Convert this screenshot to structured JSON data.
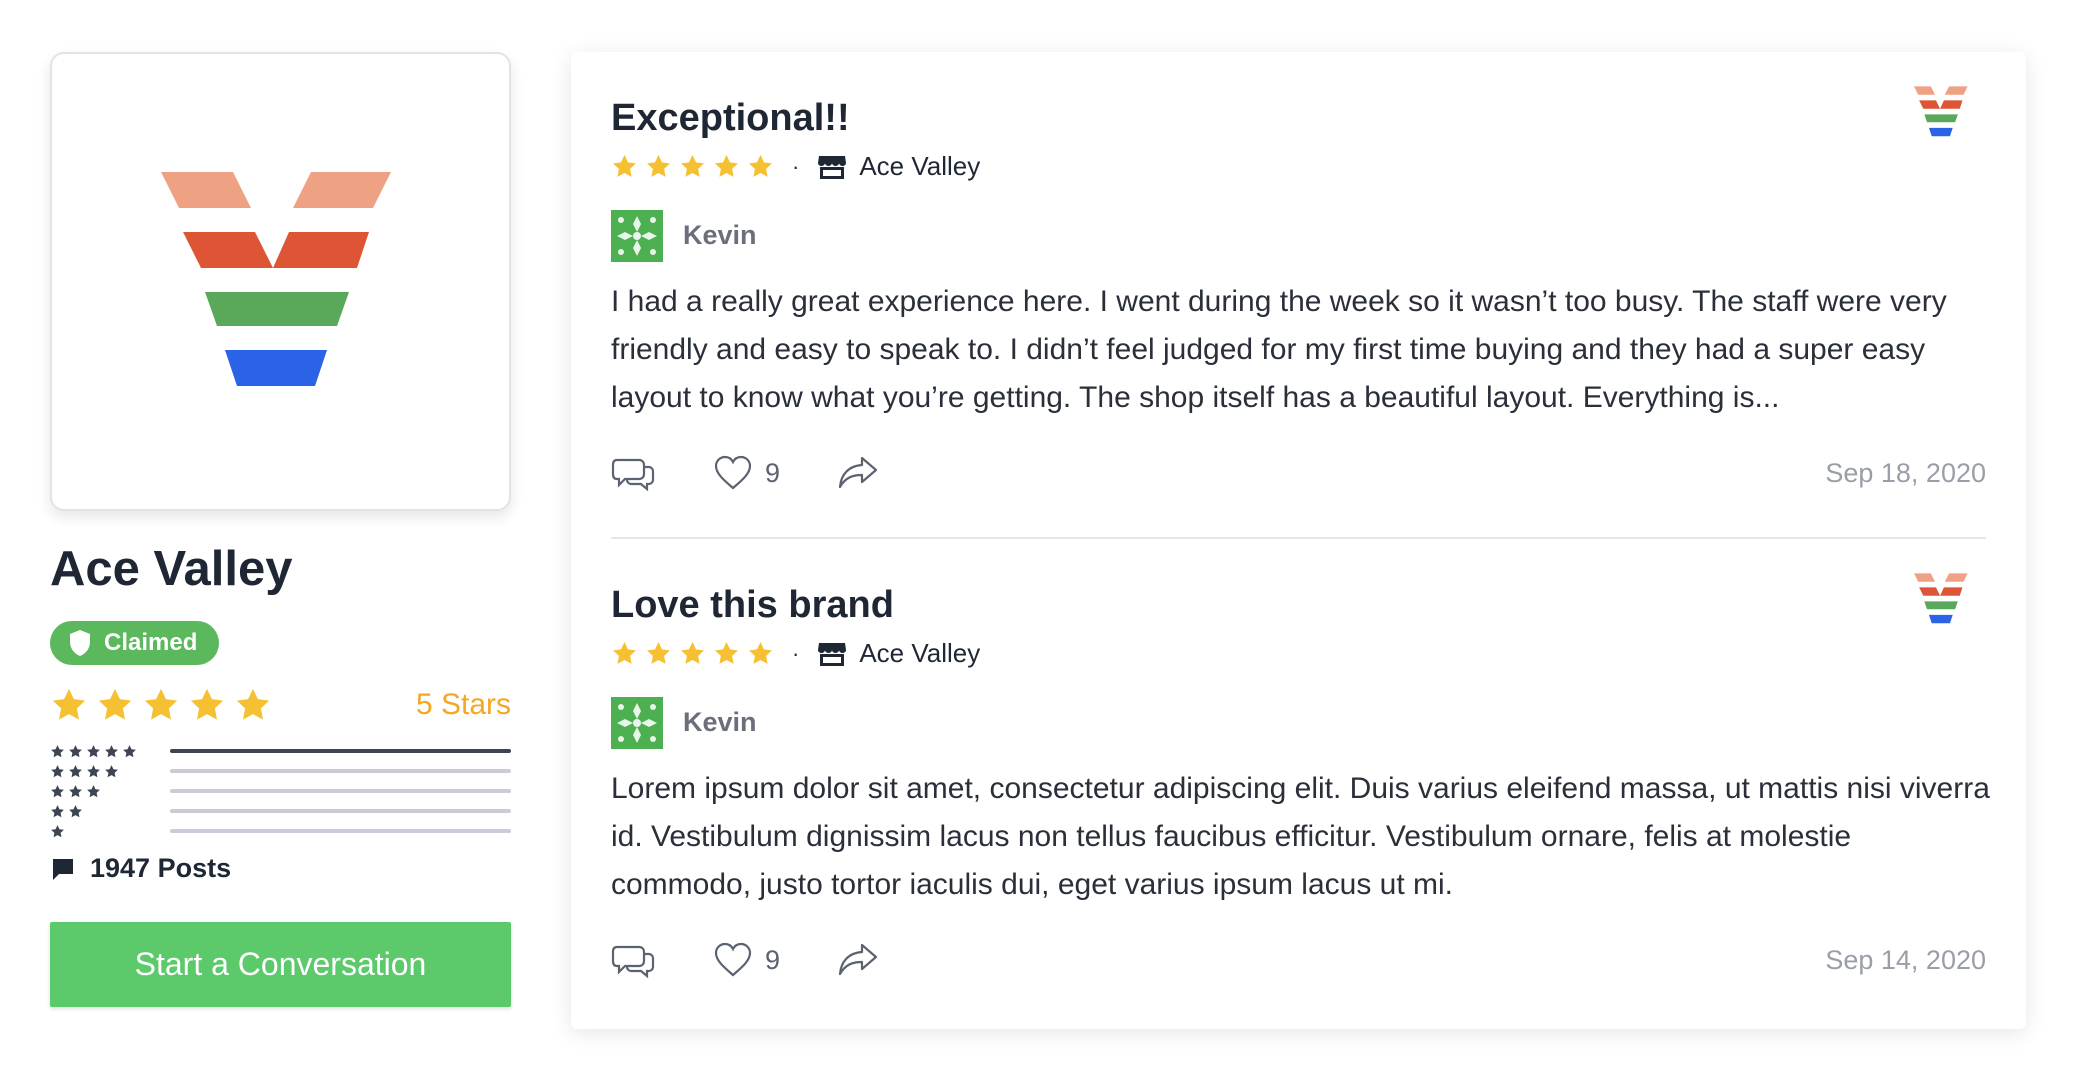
{
  "profile": {
    "logo_icon": "ace-valley-logo",
    "name": "Ace Valley",
    "claimed_label": "Claimed",
    "rating": 5,
    "rating_text": "5 Stars",
    "distribution": [
      {
        "stars": 5,
        "fraction": 1.0
      },
      {
        "stars": 4,
        "fraction": 0.0
      },
      {
        "stars": 3,
        "fraction": 0.0
      },
      {
        "stars": 2,
        "fraction": 0.0
      },
      {
        "stars": 1,
        "fraction": 0.0
      }
    ],
    "posts_label": "1947 Posts",
    "cta_label": "Start a Conversation"
  },
  "colors": {
    "claimed_green": "#5cb85c",
    "cta_green": "#5cc96b",
    "star_gold": "#f5c132",
    "stars_text_orange": "#f5a623",
    "logo_peach": "#eea283",
    "logo_red": "#dd5535",
    "logo_green": "#5aa95a",
    "logo_blue": "#2b63e6"
  },
  "reviews": [
    {
      "title": "Exceptional!!",
      "rating": 5,
      "store": "Ace Valley",
      "author": "Kevin",
      "body": "I had a really great experience here. I went during the week so it wasn’t too busy. The staff were very friendly and easy to speak to. I didn’t feel judged for my first time buying and they had a super easy layout to know what you’re getting. The shop itself has a beautiful layout. Everything is...",
      "likes": "9",
      "date": "Sep 18, 2020"
    },
    {
      "title": "Love this brand",
      "rating": 5,
      "store": "Ace Valley",
      "author": "Kevin",
      "body": "Lorem ipsum dolor sit amet, consectetur adipiscing elit. Duis varius eleifend massa, ut mattis nisi viverra id. Vestibulum dignissim lacus non tellus faucibus efficitur. Vestibulum ornare, felis at molestie commodo, justo tortor iaculis dui, eget varius ipsum lacus ut mi.",
      "likes": "9",
      "date": "Sep 14, 2020"
    }
  ]
}
